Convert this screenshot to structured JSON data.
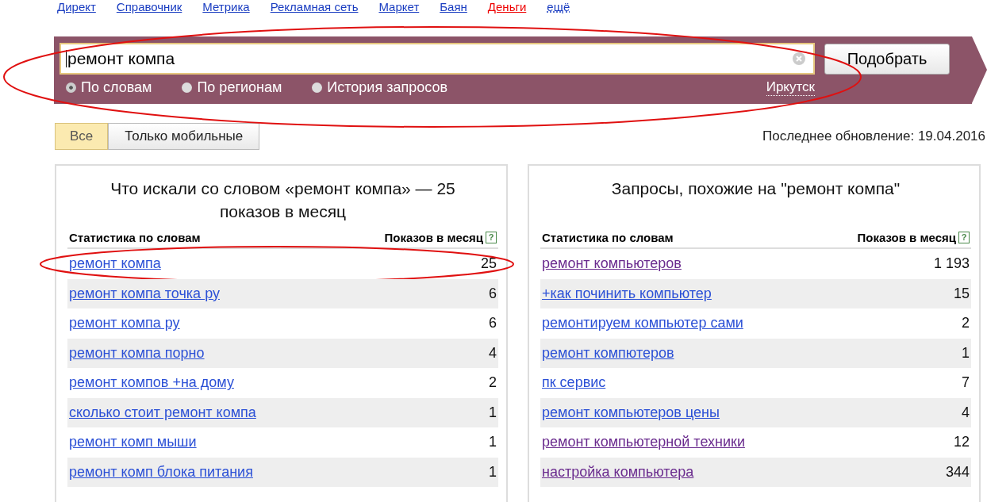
{
  "nav": [
    {
      "label": "Директ",
      "kind": "link"
    },
    {
      "label": "Справочник",
      "kind": "link"
    },
    {
      "label": "Метрика",
      "kind": "link"
    },
    {
      "label": "Рекламная сеть",
      "kind": "link"
    },
    {
      "label": "Маркет",
      "kind": "link"
    },
    {
      "label": "Баян",
      "kind": "link"
    },
    {
      "label": "Деньги",
      "kind": "accent"
    },
    {
      "label": "ещё",
      "kind": "more"
    }
  ],
  "search": {
    "value": "ремонт компа",
    "button": "Подобрать",
    "region": "Иркутск"
  },
  "modes": [
    {
      "label": "По словам",
      "selected": true
    },
    {
      "label": "По регионам",
      "selected": false
    },
    {
      "label": "История запросов",
      "selected": false
    }
  ],
  "filters": [
    {
      "label": "Все",
      "selected": true
    },
    {
      "label": "Только мобильные",
      "selected": false
    }
  ],
  "last_update": "Последнее обновление: 19.04.2016",
  "panels": [
    {
      "title": "Что искали со словом «ремонт компа» — 25 показов в месяц",
      "col_left": "Статистика по словам",
      "col_right": "Показов в месяц",
      "help": "?",
      "rows": [
        {
          "phrase": "ремонт компа",
          "count": "25",
          "visited": false
        },
        {
          "phrase": "ремонт компа точка ру",
          "count": "6",
          "visited": false
        },
        {
          "phrase": "ремонт компа ру",
          "count": "6",
          "visited": false
        },
        {
          "phrase": "ремонт компа порно",
          "count": "4",
          "visited": false
        },
        {
          "phrase": "ремонт компов +на дому",
          "count": "2",
          "visited": false
        },
        {
          "phrase": "сколько стоит ремонт компа",
          "count": "1",
          "visited": false
        },
        {
          "phrase": "ремонт комп мыши",
          "count": "1",
          "visited": false
        },
        {
          "phrase": "ремонт комп блока питания",
          "count": "1",
          "visited": false
        }
      ]
    },
    {
      "title": "Запросы, похожие на \"ремонт компа\"",
      "col_left": "Статистика по словам",
      "col_right": "Показов в месяц",
      "help": "?",
      "rows": [
        {
          "phrase": "ремонт компьютеров",
          "count": "1 193",
          "visited": true
        },
        {
          "phrase": "+как починить компьютер",
          "count": "15",
          "visited": false
        },
        {
          "phrase": "ремонтируем компьютер сами",
          "count": "2",
          "visited": false
        },
        {
          "phrase": "ремонт компютеров",
          "count": "1",
          "visited": false
        },
        {
          "phrase": "пк сервис",
          "count": "7",
          "visited": false
        },
        {
          "phrase": "ремонт компьютеров цены",
          "count": "4",
          "visited": false
        },
        {
          "phrase": "ремонт компьютерной техники",
          "count": "12",
          "visited": true
        },
        {
          "phrase": "настройка компьютера",
          "count": "344",
          "visited": true
        }
      ]
    }
  ]
}
